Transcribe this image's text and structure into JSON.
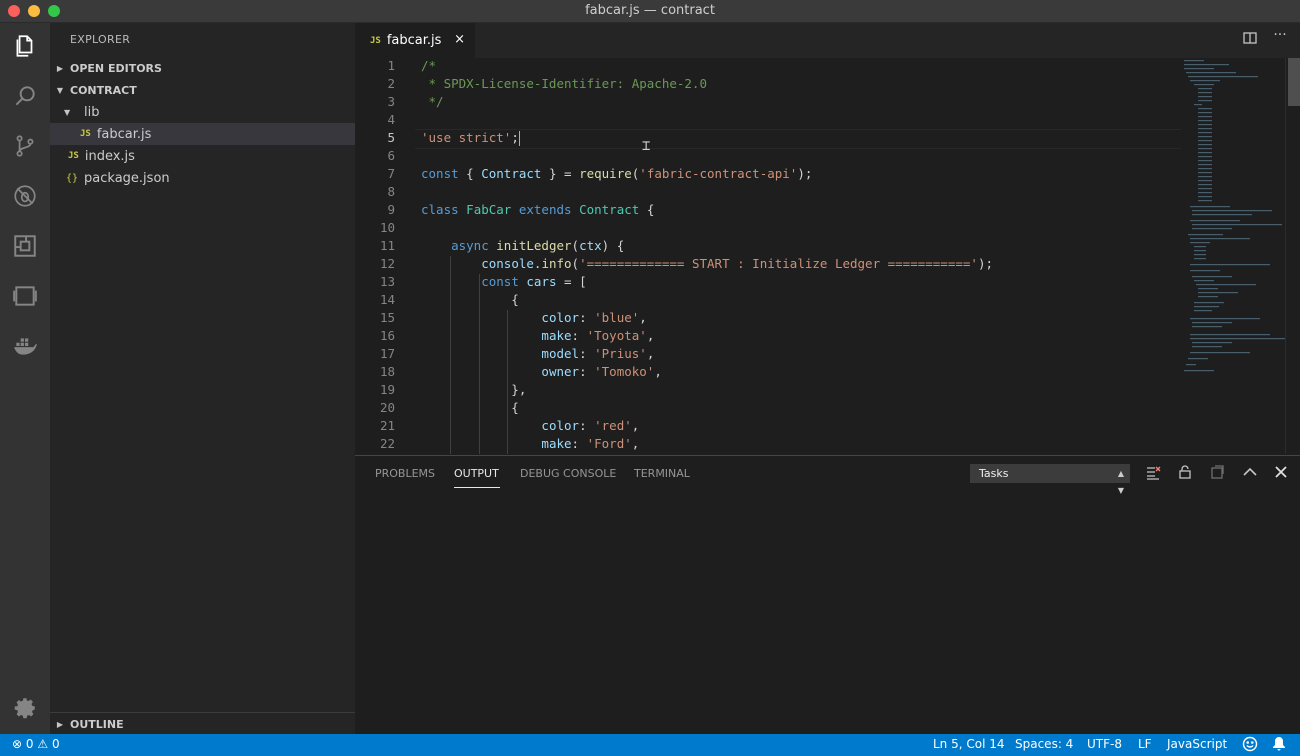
{
  "window": {
    "title": "fabcar.js — contract"
  },
  "activity_bar": {
    "items": [
      "explorer-icon",
      "search-icon",
      "source-control-icon",
      "debug-icon",
      "extensions-icon",
      "remote-explorer-icon",
      "docker-icon"
    ],
    "bottom": "gear-icon"
  },
  "sidebar": {
    "title": "EXPLORER",
    "open_editors": "OPEN EDITORS",
    "contract": "CONTRACT",
    "lib": "lib",
    "files": [
      "fabcar.js",
      "index.js",
      "package.json"
    ],
    "outline": "OUTLINE",
    "js_badge": "JS",
    "json_badge": "{}"
  },
  "tab": {
    "label": "fabcar.js",
    "close": "×"
  },
  "editor": {
    "line_numbers": [
      "1",
      "2",
      "3",
      "4",
      "5",
      "6",
      "7",
      "8",
      "9",
      "10",
      "11",
      "12",
      "13",
      "14",
      "15",
      "16",
      "17",
      "18",
      "19",
      "20",
      "21",
      "22"
    ],
    "current_line": 5,
    "lines": [
      [
        [
          "/*",
          "com"
        ]
      ],
      [
        [
          " * SPDX-License-Identifier: Apache-2.0",
          "com"
        ]
      ],
      [
        [
          " */",
          "com"
        ]
      ],
      [],
      [
        [
          "'use strict'",
          "str"
        ],
        [
          ";",
          ""
        ]
      ],
      [],
      [
        [
          "const",
          "kw"
        ],
        [
          " { ",
          ""
        ],
        [
          "Contract",
          "var"
        ],
        [
          " } = ",
          ""
        ],
        [
          "require",
          "fn"
        ],
        [
          "(",
          ""
        ],
        [
          "'fabric-contract-api'",
          "str"
        ],
        [
          ");",
          ""
        ]
      ],
      [],
      [
        [
          "class",
          "kw"
        ],
        [
          " ",
          ""
        ],
        [
          "FabCar",
          "cls"
        ],
        [
          " ",
          ""
        ],
        [
          "extends",
          "kw"
        ],
        [
          " ",
          ""
        ],
        [
          "Contract",
          "cls"
        ],
        [
          " {",
          ""
        ]
      ],
      [],
      [
        [
          "    ",
          ""
        ],
        [
          "async",
          "kw"
        ],
        [
          " ",
          ""
        ],
        [
          "initLedger",
          "fn"
        ],
        [
          "(",
          ""
        ],
        [
          "ctx",
          "var"
        ],
        [
          ") {",
          ""
        ]
      ],
      [
        [
          "        ",
          ""
        ],
        [
          "console",
          "var"
        ],
        [
          ".",
          ""
        ],
        [
          "info",
          "fn"
        ],
        [
          "(",
          ""
        ],
        [
          "'============= START : Initialize Ledger ==========='",
          "str"
        ],
        [
          ");",
          ""
        ]
      ],
      [
        [
          "        ",
          ""
        ],
        [
          "const",
          "kw"
        ],
        [
          " ",
          ""
        ],
        [
          "cars",
          "var"
        ],
        [
          " = [",
          ""
        ]
      ],
      [
        [
          "            {",
          ""
        ]
      ],
      [
        [
          "                ",
          ""
        ],
        [
          "color",
          "var"
        ],
        [
          ": ",
          ""
        ],
        [
          "'blue'",
          "str"
        ],
        [
          ",",
          ""
        ]
      ],
      [
        [
          "                ",
          ""
        ],
        [
          "make",
          "var"
        ],
        [
          ": ",
          ""
        ],
        [
          "'Toyota'",
          "str"
        ],
        [
          ",",
          ""
        ]
      ],
      [
        [
          "                ",
          ""
        ],
        [
          "model",
          "var"
        ],
        [
          ": ",
          ""
        ],
        [
          "'Prius'",
          "str"
        ],
        [
          ",",
          ""
        ]
      ],
      [
        [
          "                ",
          ""
        ],
        [
          "owner",
          "var"
        ],
        [
          ": ",
          ""
        ],
        [
          "'Tomoko'",
          "str"
        ],
        [
          ",",
          ""
        ]
      ],
      [
        [
          "            },",
          ""
        ]
      ],
      [
        [
          "            {",
          ""
        ]
      ],
      [
        [
          "                ",
          ""
        ],
        [
          "color",
          "var"
        ],
        [
          ": ",
          ""
        ],
        [
          "'red'",
          "str"
        ],
        [
          ",",
          ""
        ]
      ],
      [
        [
          "                ",
          ""
        ],
        [
          "make",
          "var"
        ],
        [
          ": ",
          ""
        ],
        [
          "'Ford'",
          "str"
        ],
        [
          ",",
          ""
        ]
      ]
    ]
  },
  "panel": {
    "tabs": [
      "PROBLEMS",
      "OUTPUT",
      "DEBUG CONSOLE",
      "TERMINAL"
    ],
    "active_tab": "OUTPUT",
    "select_value": "Tasks"
  },
  "statusbar": {
    "errors": "0",
    "warnings": "0",
    "position": "Ln 5, Col 14",
    "spaces": "Spaces: 4",
    "encoding": "UTF-8",
    "eol": "LF",
    "language": "JavaScript"
  },
  "colors": {
    "accent": "#007acc",
    "string": "#ce9178",
    "keyword": "#569cd6",
    "comment": "#6a9955"
  }
}
